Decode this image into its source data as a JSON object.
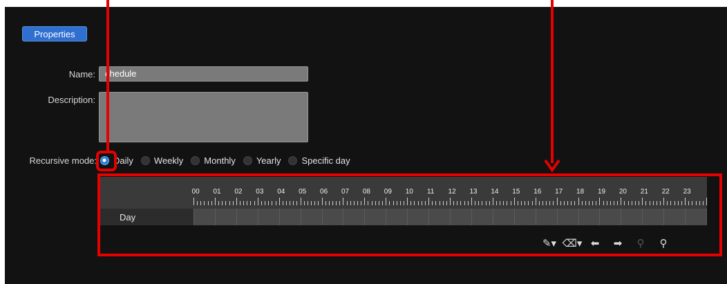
{
  "tab": {
    "label": "Properties"
  },
  "form": {
    "name_label": "Name:",
    "name_value": "chedule",
    "description_label": "Description:",
    "description_value": "",
    "recursive_label": "Recursive mode:",
    "options": [
      {
        "label": "Daily",
        "selected": true
      },
      {
        "label": "Weekly",
        "selected": false
      },
      {
        "label": "Monthly",
        "selected": false
      },
      {
        "label": "Yearly",
        "selected": false
      },
      {
        "label": "Specific day",
        "selected": false
      }
    ]
  },
  "timeline": {
    "hours": [
      "00",
      "01",
      "02",
      "03",
      "04",
      "05",
      "06",
      "07",
      "08",
      "09",
      "10",
      "11",
      "12",
      "13",
      "14",
      "15",
      "16",
      "17",
      "18",
      "19",
      "20",
      "21",
      "22",
      "23"
    ],
    "row_label": "Day"
  },
  "toolbar": {
    "icons": [
      "pencil-dropdown-icon",
      "eraser-dropdown-icon",
      "arrow-left-icon",
      "arrow-right-icon",
      "zoom-out-icon",
      "zoom-in-icon"
    ]
  },
  "colors": {
    "accent": "#2f6fd0",
    "annotation": "#e60000",
    "background": "#121212"
  }
}
